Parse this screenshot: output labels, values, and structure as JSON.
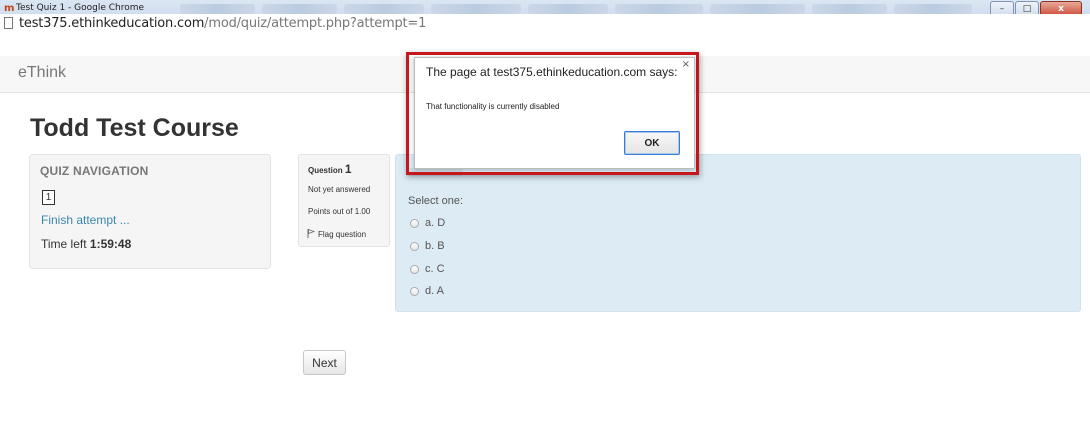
{
  "window": {
    "title": "Test Quiz 1 - Google Chrome",
    "url_host": "test375.ethinkeducation.com",
    "url_path": "/mod/quiz/attempt.php?attempt=1",
    "minimize_glyph": "–",
    "maximize_glyph": "□",
    "close_glyph": "x"
  },
  "site": {
    "brand": "eThink"
  },
  "page": {
    "course_title": "Todd Test Course"
  },
  "quiz_nav": {
    "title": "QUIZ NAVIGATION",
    "question_buttons": [
      "1"
    ],
    "finish_label": "Finish attempt ...",
    "time_left_label": "Time left ",
    "time_left_value": "1:59:48"
  },
  "question": {
    "label": "Question ",
    "number": "1",
    "state": "Not yet answered",
    "grade": "Points out of 1.00",
    "flag_label": "Flag question",
    "select_label": "Select one:",
    "answers": [
      "a. D",
      "b. B",
      "c. C",
      "d. A"
    ]
  },
  "next_label": "Next",
  "dialog": {
    "title": "The page at test375.ethinkeducation.com says:",
    "message": "That functionality is currently disabled",
    "ok_label": "OK",
    "close_glyph": "×"
  },
  "colors": {
    "highlight_border": "#c8161d",
    "link": "#3a87ad",
    "question_bg": "#dcebf4"
  }
}
